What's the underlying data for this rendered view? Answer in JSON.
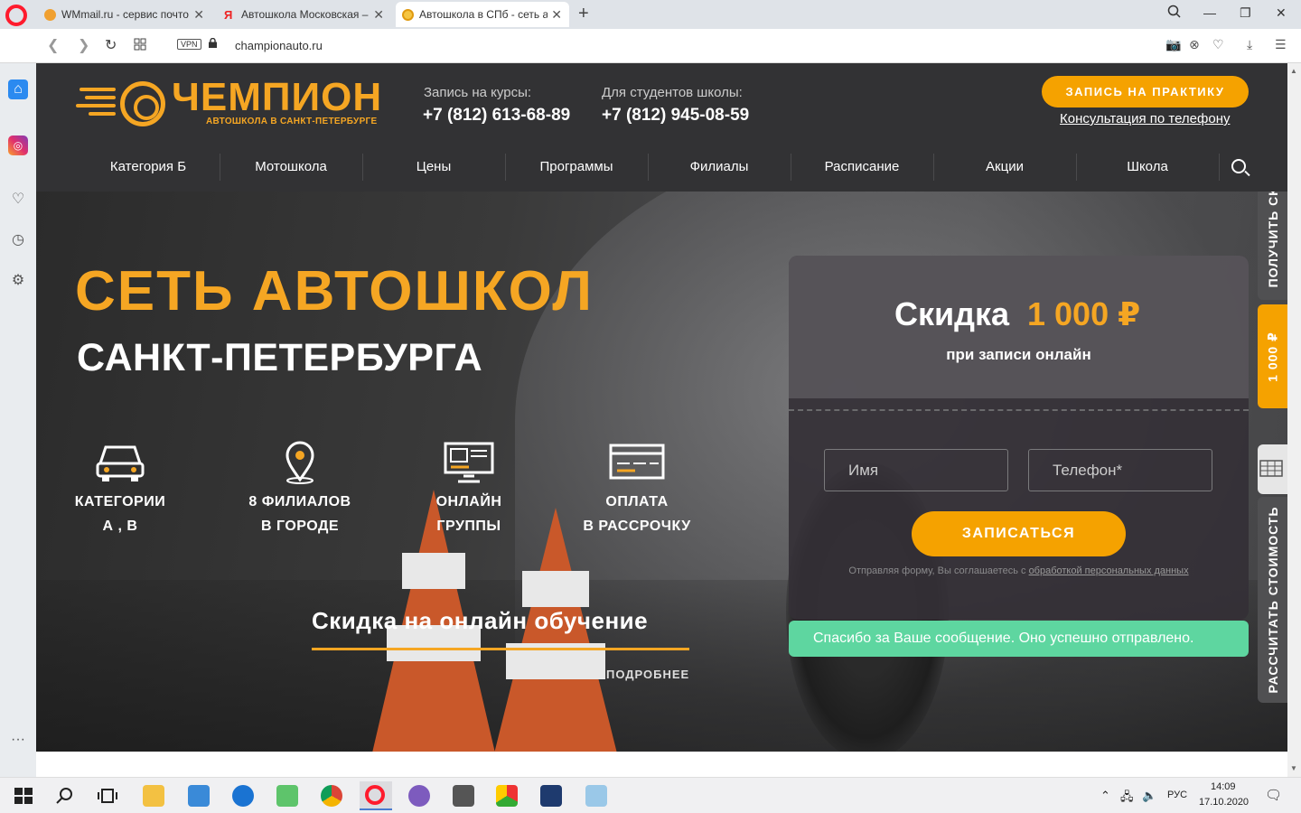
{
  "browser": {
    "tabs": [
      {
        "title": "WMmail.ru - сервис почто",
        "active": false
      },
      {
        "title": "Автошкола Московская – ",
        "active": false
      },
      {
        "title": "Автошкола в СПб - сеть а",
        "active": true
      }
    ],
    "url": "championauto.ru",
    "vpn_label": "VPN"
  },
  "site": {
    "logo": {
      "name": "ЧЕМПИОН",
      "tagline": "АВТОШКОЛА В САНКТ-ПЕТЕРБУРГЕ"
    },
    "contacts": [
      {
        "label": "Запись на курсы:",
        "phone": "+7 (812) 613-68-89"
      },
      {
        "label": "Для студентов школы:",
        "phone": "+7 (812) 945-08-59"
      }
    ],
    "practice_button": "ЗАПИСЬ НА ПРАКТИКУ",
    "consult_link": "Консультация по телефону",
    "menu": [
      "Категория Б",
      "Мотошкола",
      "Цены",
      "Программы",
      "Филиалы",
      "Расписание",
      "Акции",
      "Школа"
    ],
    "hero": {
      "title": "СЕТЬ АВТОШКОЛ",
      "subtitle": "САНКТ-ПЕТЕРБУРГА",
      "features": [
        {
          "icon": "car-icon",
          "line1": "КАТЕГОРИИ",
          "line2": "А , В"
        },
        {
          "icon": "location-pin-icon",
          "line1": "8 ФИЛИАЛОВ",
          "line2": "В ГОРОДЕ"
        },
        {
          "icon": "monitor-icon",
          "line1": "ОНЛАЙН",
          "line2": "ГРУППЫ"
        },
        {
          "icon": "credit-card-icon",
          "line1": "ОПЛАТА",
          "line2": "В РАССРОЧКУ"
        }
      ],
      "promo_title": "Скидка на онлайн обучение",
      "more_link": "ПОДРОБНЕЕ"
    },
    "form": {
      "discount_word": "Скидка",
      "discount_amount": "1 000 ₽",
      "discount_note": "при записи онлайн",
      "name_placeholder": "Имя",
      "phone_placeholder": "Телефон*",
      "submit": "ЗАПИСАТЬСЯ",
      "agree_text": "Отправляя форму, Вы соглашаетесь с ",
      "agree_link": "обработкой персональных данных",
      "success": "Спасибо за Ваше сообщение. Оно успешно отправлено."
    },
    "side_tabs": {
      "discount": "ПОЛУЧИТЬ СКИДКУ",
      "amount": "1 000 ₽",
      "calc": "РАССЧИТАТЬ СТОИМОСТЬ"
    }
  },
  "taskbar": {
    "lang": "РУС",
    "time": "14:09",
    "date": "17.10.2020"
  },
  "colors": {
    "accent": "#f5a200",
    "success": "#5ed6a0",
    "header_bg": "#323234"
  }
}
